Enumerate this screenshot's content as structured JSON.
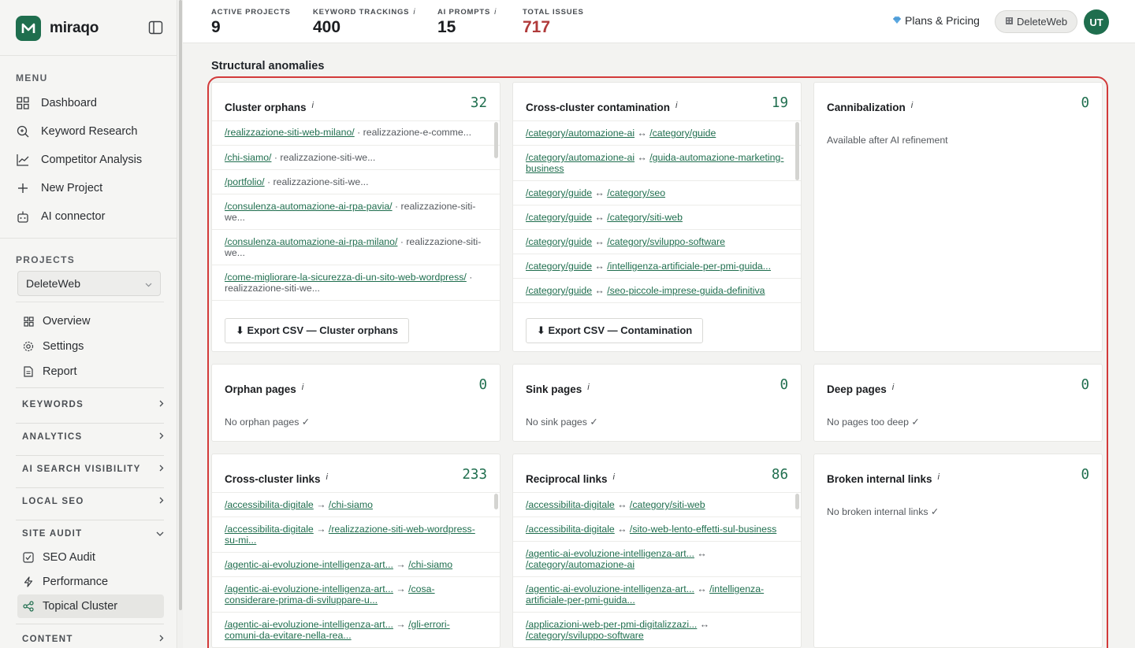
{
  "app": {
    "name": "miraqo"
  },
  "sidebar": {
    "menu_title": "MENU",
    "menu": [
      {
        "label": "Dashboard",
        "icon": "grid-icon"
      },
      {
        "label": "Keyword Research",
        "icon": "search-icon"
      },
      {
        "label": "Competitor Analysis",
        "icon": "line-chart-icon"
      },
      {
        "label": "New Project",
        "icon": "plus-icon"
      },
      {
        "label": "AI connector",
        "icon": "robot-icon"
      }
    ],
    "projects_title": "PROJECTS",
    "project_selected": "DeleteWeb",
    "project_items": [
      {
        "label": "Overview",
        "icon": "grid-icon"
      },
      {
        "label": "Settings",
        "icon": "gear-icon"
      },
      {
        "label": "Report",
        "icon": "document-icon"
      }
    ],
    "groups": [
      {
        "label": "KEYWORDS"
      },
      {
        "label": "ANALYTICS"
      },
      {
        "label": "AI SEARCH VISIBILITY"
      },
      {
        "label": "LOCAL SEO"
      }
    ],
    "site_audit": {
      "label": "SITE AUDIT",
      "items": [
        {
          "label": "SEO Audit",
          "icon": "check-square-icon"
        },
        {
          "label": "Performance",
          "icon": "bolt-icon"
        },
        {
          "label": "Topical Cluster",
          "icon": "share-icon"
        }
      ]
    },
    "content_group": {
      "label": "CONTENT"
    }
  },
  "topbar": {
    "stats": [
      {
        "label": "ACTIVE PROJECTS",
        "value": "9",
        "info": ""
      },
      {
        "label": "KEYWORD TRACKINGS",
        "value": "400",
        "info": "i"
      },
      {
        "label": "AI PROMPTS",
        "value": "15",
        "info": "i"
      },
      {
        "label": "TOTAL ISSUES",
        "value": "717",
        "info": ""
      }
    ],
    "plans_label": "Plans & Pricing",
    "workspace": "DeleteWeb",
    "avatar": "UT"
  },
  "section_title": "Structural anomalies",
  "colors": {
    "accent": "#1f6e4e",
    "issues": "#b03a3a",
    "highlight": "#d23a3a"
  },
  "cards": {
    "cluster_orphans": {
      "title": "Cluster orphans",
      "info": "i",
      "count": "32",
      "rows": [
        {
          "link": "/realizzazione-siti-web-milano/",
          "rest": " · realizzazione-e-comme..."
        },
        {
          "link": "/chi-siamo/",
          "rest": " · realizzazione-siti-we..."
        },
        {
          "link": "/portfolio/",
          "rest": " · realizzazione-siti-we..."
        },
        {
          "link": "/consulenza-automazione-ai-rpa-pavia/",
          "rest": " · realizzazione-siti-we..."
        },
        {
          "link": "/consulenza-automazione-ai-rpa-milano/",
          "rest": " · realizzazione-siti-we..."
        },
        {
          "link": "/come-migliorare-la-sicurezza-di-un-sito-web-wordpress/",
          "rest": " · realizzazione-siti-we..."
        }
      ],
      "export": "⬇ Export CSV — Cluster orphans"
    },
    "contamination": {
      "title": "Cross-cluster contamination",
      "info": "i",
      "count": "19",
      "rows": [
        {
          "a": "/category/automazione-ai",
          "sep": " ↔ ",
          "b": "/category/guide"
        },
        {
          "a": "/category/automazione-ai",
          "sep": " ↔ ",
          "b": "/guida-automazione-marketing-business"
        },
        {
          "a": "/category/guide",
          "sep": " ↔ ",
          "b": "/category/seo"
        },
        {
          "a": "/category/guide",
          "sep": " ↔ ",
          "b": "/category/siti-web"
        },
        {
          "a": "/category/guide",
          "sep": " ↔ ",
          "b": "/category/sviluppo-software"
        },
        {
          "a": "/category/guide",
          "sep": " ↔ ",
          "b": "/intelligenza-artificiale-per-pmi-guida..."
        },
        {
          "a": "/category/guide",
          "sep": " ↔ ",
          "b": "/seo-piccole-imprese-guida-definitiva"
        }
      ],
      "export": "⬇ Export CSV — Contamination"
    },
    "cannibalization": {
      "title": "Cannibalization",
      "info": "i",
      "count": "0",
      "note": "Available after AI refinement"
    },
    "orphan_pages": {
      "title": "Orphan pages",
      "info": "i",
      "count": "0",
      "note": "No orphan pages ✓"
    },
    "sink_pages": {
      "title": "Sink pages",
      "info": "i",
      "count": "0",
      "note": "No sink pages ✓"
    },
    "deep_pages": {
      "title": "Deep pages",
      "info": "i",
      "count": "0",
      "note": "No pages too deep ✓"
    },
    "cross_links": {
      "title": "Cross-cluster links",
      "info": "i",
      "count": "233",
      "rows": [
        {
          "a": "/accessibilita-digitale",
          "sep": " → ",
          "b": "/chi-siamo"
        },
        {
          "a": "/accessibilita-digitale",
          "sep": " → ",
          "b": "/realizzazione-siti-web-wordpress-su-mi..."
        },
        {
          "a": "/agentic-ai-evoluzione-intelligenza-art...",
          "sep": " → ",
          "b": "/chi-siamo"
        },
        {
          "a": "/agentic-ai-evoluzione-intelligenza-art...",
          "sep": " → ",
          "b": "/cosa-considerare-prima-di-sviluppare-u..."
        },
        {
          "a": "/agentic-ai-evoluzione-intelligenza-art...",
          "sep": " → ",
          "b": "/gli-errori-comuni-da-evitare-nella-rea..."
        }
      ]
    },
    "reciprocal_links": {
      "title": "Reciprocal links",
      "info": "i",
      "count": "86",
      "rows": [
        {
          "a": "/accessibilita-digitale",
          "sep": " ↔ ",
          "b": "/category/siti-web"
        },
        {
          "a": "/accessibilita-digitale",
          "sep": " ↔ ",
          "b": "/sito-web-lento-effetti-sul-business"
        },
        {
          "a": "/agentic-ai-evoluzione-intelligenza-art...",
          "sep": " ↔ ",
          "b": "/category/automazione-ai"
        },
        {
          "a": "/agentic-ai-evoluzione-intelligenza-art...",
          "sep": " ↔ ",
          "b": "/intelligenza-artificiale-per-pmi-guida..."
        },
        {
          "a": "/applicazioni-web-per-pmi-digitalizzazi...",
          "sep": " ↔ ",
          "b": "/category/sviluppo-software"
        }
      ]
    },
    "broken_links": {
      "title": "Broken internal links",
      "info": "i",
      "count": "0",
      "note": "No broken internal links ✓"
    }
  }
}
